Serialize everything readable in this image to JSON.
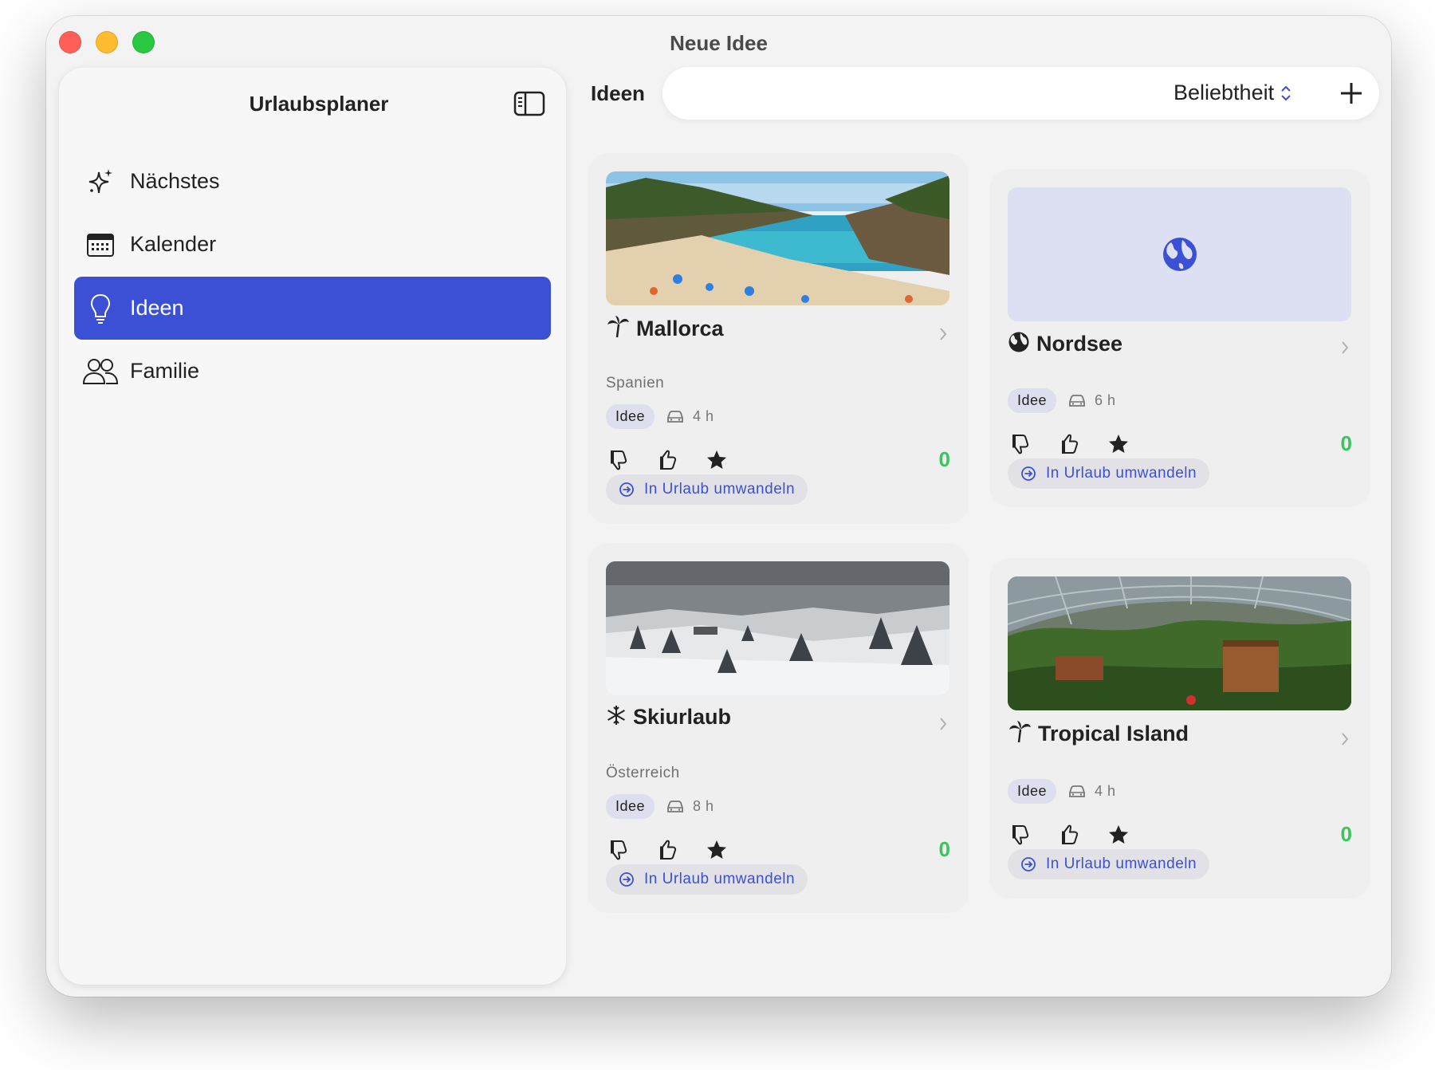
{
  "window": {
    "title": "Neue Idee"
  },
  "sidebar": {
    "title": "Urlaubsplaner",
    "toggle_icon": "sidebar-toggle-icon",
    "items": [
      {
        "label": "Nächstes",
        "icon": "sparkles-icon",
        "active": false
      },
      {
        "label": "Kalender",
        "icon": "calendar-icon",
        "active": false
      },
      {
        "label": "Ideen",
        "icon": "lightbulb-icon",
        "active": true
      },
      {
        "label": "Familie",
        "icon": "people-icon",
        "active": false
      }
    ]
  },
  "main": {
    "title": "Ideen",
    "sort_label": "Beliebtheit",
    "add_icon": "plus-icon"
  },
  "colors": {
    "accent": "#3b50d4",
    "score": "#34c759",
    "placeholder_bg": "#dde0f2"
  },
  "cards": [
    {
      "title": "Mallorca",
      "icon": "palm-tree-icon",
      "subtitle": "Spanien",
      "tag": "Idee",
      "duration": "4 h",
      "score": "0",
      "convert_label": "In Urlaub umwandeln",
      "image": "beach-photo"
    },
    {
      "title": "Nordsee",
      "icon": "globe-icon",
      "subtitle": "",
      "tag": "Idee",
      "duration": "6 h",
      "score": "0",
      "convert_label": "In Urlaub umwandeln",
      "image": "globe-placeholder"
    },
    {
      "title": "Skiurlaub",
      "icon": "snowflake-icon",
      "subtitle": "Österreich",
      "tag": "Idee",
      "duration": "8 h",
      "score": "0",
      "convert_label": "In Urlaub umwandeln",
      "image": "snow-photo"
    },
    {
      "title": "Tropical Island",
      "icon": "palm-tree-icon",
      "subtitle": "",
      "tag": "Idee",
      "duration": "4 h",
      "score": "0",
      "convert_label": "In Urlaub umwandeln",
      "image": "dome-photo"
    }
  ]
}
